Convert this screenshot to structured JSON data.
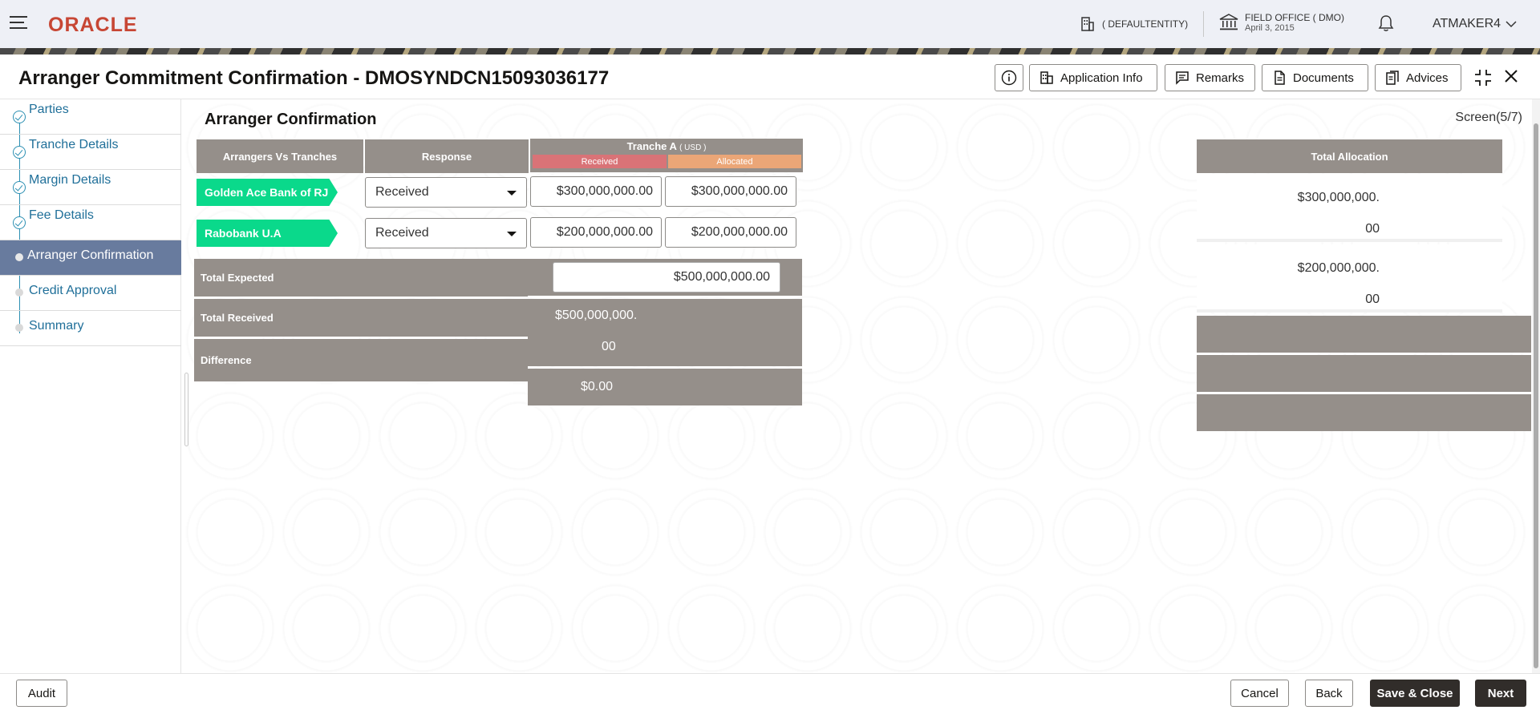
{
  "header": {
    "brand": "ORACLE",
    "entity": "( DEFAULTENTITY)",
    "office_name": "FIELD OFFICE ( DMO)",
    "office_date": "April 3, 2015",
    "user": "ATMAKER4"
  },
  "titlebar": {
    "title": "Arranger Commitment Confirmation - DMOSYNDCN15093036177",
    "buttons": {
      "application_info": "Application Info",
      "remarks": "Remarks",
      "documents": "Documents",
      "advices": "Advices"
    }
  },
  "sidebar": {
    "items": [
      {
        "label": "Parties",
        "state": "done"
      },
      {
        "label": "Tranche Details",
        "state": "done"
      },
      {
        "label": "Margin Details",
        "state": "done"
      },
      {
        "label": "Fee Details",
        "state": "done"
      },
      {
        "label": "Arranger Confirmation",
        "state": "active"
      },
      {
        "label": "Credit Approval",
        "state": "pending"
      },
      {
        "label": "Summary",
        "state": "pending"
      }
    ]
  },
  "main": {
    "section_title": "Arranger Confirmation",
    "screen_counter": "Screen(5/7)",
    "table": {
      "col_arrangers": "Arrangers Vs Tranches",
      "col_response": "Response",
      "tranche_title": "Tranche A",
      "tranche_currency": "( USD )",
      "sub_received": "Received",
      "sub_allocated": "Allocated",
      "rows": [
        {
          "arranger": "Golden Ace Bank of RJ",
          "response": "Received",
          "received": "$300,000,000.00",
          "allocated": "$300,000,000.00"
        },
        {
          "arranger": "Rabobank U.A",
          "response": "Received",
          "received": "$200,000,000.00",
          "allocated": "$200,000,000.00"
        }
      ],
      "total_expected_label": "Total Expected",
      "total_expected_value": "$500,000,000.00",
      "total_received_label": "Total Received",
      "total_received_value_line1": "$500,000,000.",
      "total_received_value_line2": "00",
      "difference_label": "Difference",
      "difference_value": "$0.00"
    },
    "total_allocation": {
      "header": "Total Allocation",
      "rows": [
        {
          "line1": "$300,000,000.",
          "line2": "00"
        },
        {
          "line1": "$200,000,000.",
          "line2": "00"
        }
      ]
    }
  },
  "footer": {
    "audit": "Audit",
    "cancel": "Cancel",
    "back": "Back",
    "save_close": "Save & Close",
    "next": "Next"
  },
  "colors": {
    "brand": "#c74634",
    "arranger_tag": "#0ad98b",
    "received_header": "#d97377",
    "allocated_header": "#eba677",
    "active_nav": "#687b9e",
    "table_header": "#958f8a"
  }
}
